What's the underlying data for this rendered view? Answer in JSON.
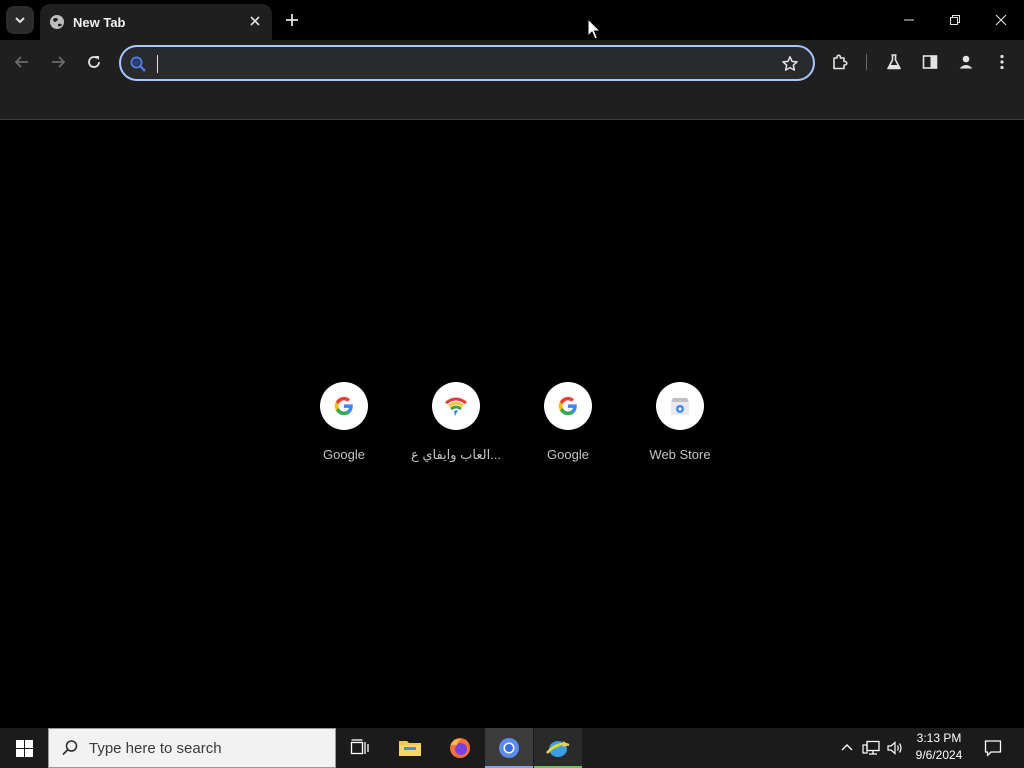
{
  "browser": {
    "tabs": [
      {
        "title": "New Tab",
        "active": true
      }
    ],
    "omnibox": {
      "value": "",
      "placeholder": ""
    }
  },
  "new_tab_page": {
    "shortcuts": [
      {
        "label": "Google",
        "icon": "google-g-icon"
      },
      {
        "label": "العاب وايفاي ع...",
        "icon": "arabic-site-icon"
      },
      {
        "label": "Google",
        "icon": "google-g-icon"
      },
      {
        "label": "Web Store",
        "icon": "web-store-icon"
      }
    ]
  },
  "taskbar": {
    "search_placeholder": "Type here to search",
    "clock": {
      "time": "3:13 PM",
      "date": "9/6/2024"
    }
  },
  "colors": {
    "background": "#000000",
    "toolbar": "#1f1f1f",
    "omnibox_focus": "#a8c7fa",
    "taskbar": "#1b1b1b"
  }
}
